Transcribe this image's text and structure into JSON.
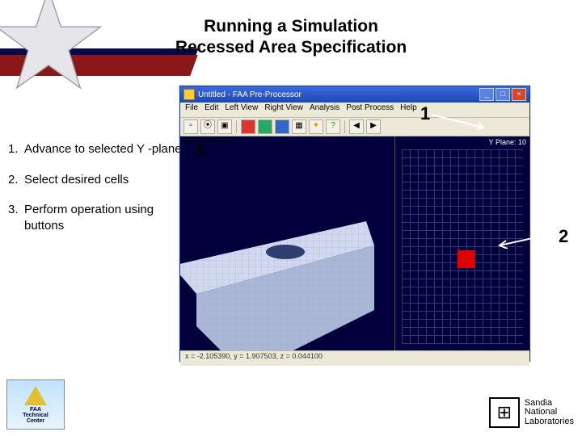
{
  "title_line1": "Running a Simulation",
  "title_line2": "Recessed Area Specification",
  "instructions": [
    {
      "n": "1.",
      "text": "Advance to selected Y -plane"
    },
    {
      "n": "2.",
      "text": "Select desired cells"
    },
    {
      "n": "3.",
      "text": "Perform operation using buttons"
    }
  ],
  "app": {
    "title": "Untitled - FAA Pre-Processor",
    "menus": [
      "File",
      "Edit",
      "Left View",
      "Right View",
      "Analysis",
      "Post Process",
      "Help"
    ],
    "yplane_label": "Y Plane: 10",
    "status": "x = -2.105390, y = 1.907503, z = 0.044100",
    "win_btns": {
      "min": "_",
      "max": "□",
      "close": "×"
    }
  },
  "callouts": {
    "c1": "1",
    "c2": "2",
    "c3": "3"
  },
  "logos": {
    "faa_l1": "FAA",
    "faa_l2": "Technical",
    "faa_l3": "Center",
    "snl_glyph": "⊞",
    "snl_l1": "Sandia",
    "snl_l2": "National",
    "snl_l3": "Laboratories"
  }
}
